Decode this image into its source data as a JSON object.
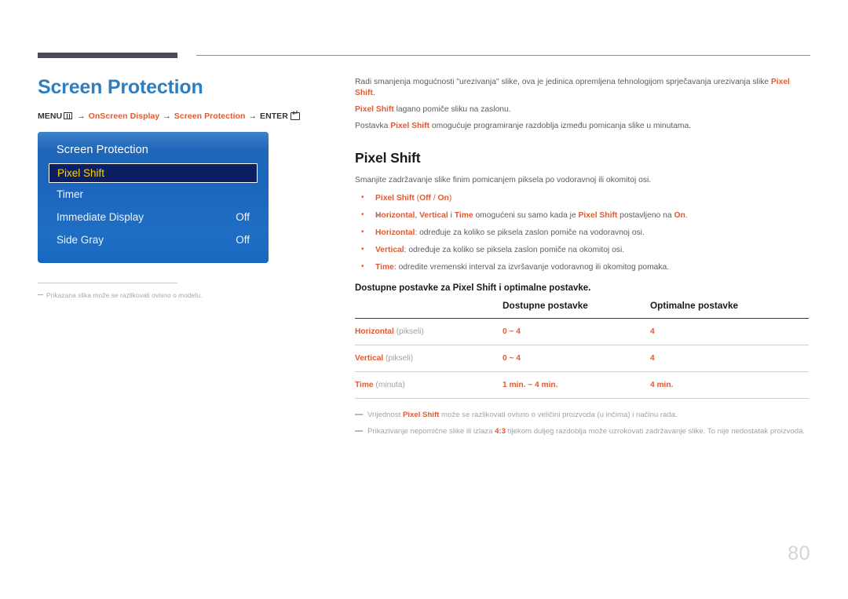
{
  "header": {
    "rule_left": "thick-dark-bar",
    "rule_right": "thin-gray-line"
  },
  "page": {
    "title": "Screen Protection",
    "number": "80",
    "title_color": "#2f7fc0",
    "accent_color": "#e05a33"
  },
  "menu_path": {
    "menu_label": "MENU",
    "arrow": "→",
    "step1": "OnScreen Display",
    "step2": "Screen Protection",
    "enter_label": "ENTER"
  },
  "osd": {
    "title": "Screen Protection",
    "rows": [
      {
        "label": "Pixel Shift",
        "value": "",
        "selected": true
      },
      {
        "label": "Timer",
        "value": "",
        "selected": false
      },
      {
        "label": "Immediate Display",
        "value": "Off",
        "selected": false
      },
      {
        "label": "Side Gray",
        "value": "Off",
        "selected": false
      }
    ]
  },
  "left_note": "Prikazana slika može se razlikovati ovisno o modelu.",
  "intro": {
    "p1_a": "Radi smanjenja mogućnosti \"urezivanja\" slike, ova je jedinica opremljena tehnologijom sprječavanja urezivanja slike ",
    "p1_b": "Pixel Shift",
    "p1_c": ".",
    "p2_a": "Pixel Shift",
    "p2_b": " lagano pomiče sliku na zaslonu.",
    "p3_a": "Postavka ",
    "p3_b": "Pixel Shift",
    "p3_c": " omogućuje programiranje razdoblja između pomicanja slike u minutama."
  },
  "section": {
    "title": "Pixel Shift",
    "lead": "Smanjite zadržavanje slike finim pomicanjem piksela po vodoravnoj ili okomitoj osi."
  },
  "bullets": {
    "b1_name": "Pixel Shift",
    "b1_rest": " (Off / On)",
    "b1_off": "Off",
    "b1_sep": " / ",
    "b1_on": "On",
    "subnote_1": "Horizontal",
    "subnote_2": ", ",
    "subnote_3": "Vertical",
    "subnote_4": " i ",
    "subnote_5": "Time",
    "subnote_6": " omogućeni su samo kada je ",
    "subnote_7": "Pixel Shift",
    "subnote_8": " postavljeno na ",
    "subnote_9": "On",
    "subnote_10": ".",
    "b2_name": "Horizontal",
    "b2_rest": ": određuje za koliko se piksela zaslon pomiče na vodoravnoj osi.",
    "b3_name": "Vertical",
    "b3_rest": ": određuje za koliko se piksela zaslon pomiče na okomitoj osi.",
    "b4_name": "Time",
    "b4_rest": ": odredite vremenski interval za izvršavanje vodoravnog ili okomitog pomaka."
  },
  "table": {
    "caption": "Dostupne postavke za Pixel Shift i optimalne postavke.",
    "headers": [
      "",
      "Dostupne postavke",
      "Optimalne postavke"
    ],
    "rows": [
      {
        "name": "Horizontal",
        "unit": " (pikseli)",
        "available": "0 ~ 4",
        "optimal": "4"
      },
      {
        "name": "Vertical",
        "unit": " (pikseli)",
        "available": "0 ~ 4",
        "optimal": "4"
      },
      {
        "name": "Time",
        "unit": " (minuta)",
        "available": "1 min. ~ 4 min.",
        "optimal": "4 min."
      }
    ]
  },
  "footnotes": {
    "f1_a": "Vrijednost ",
    "f1_b": "Pixel Shift",
    "f1_c": " može se razlikovati ovisno o veličini proizvoda (u inčima) i načinu rada.",
    "f2_a": "Prikazivanje nepomične slike ili izlaza ",
    "f2_b": "4:3",
    "f2_c": " tijekom duljeg razdoblja može uzrokovati zadržavanje slike. To nije nedostatak proizvoda."
  }
}
